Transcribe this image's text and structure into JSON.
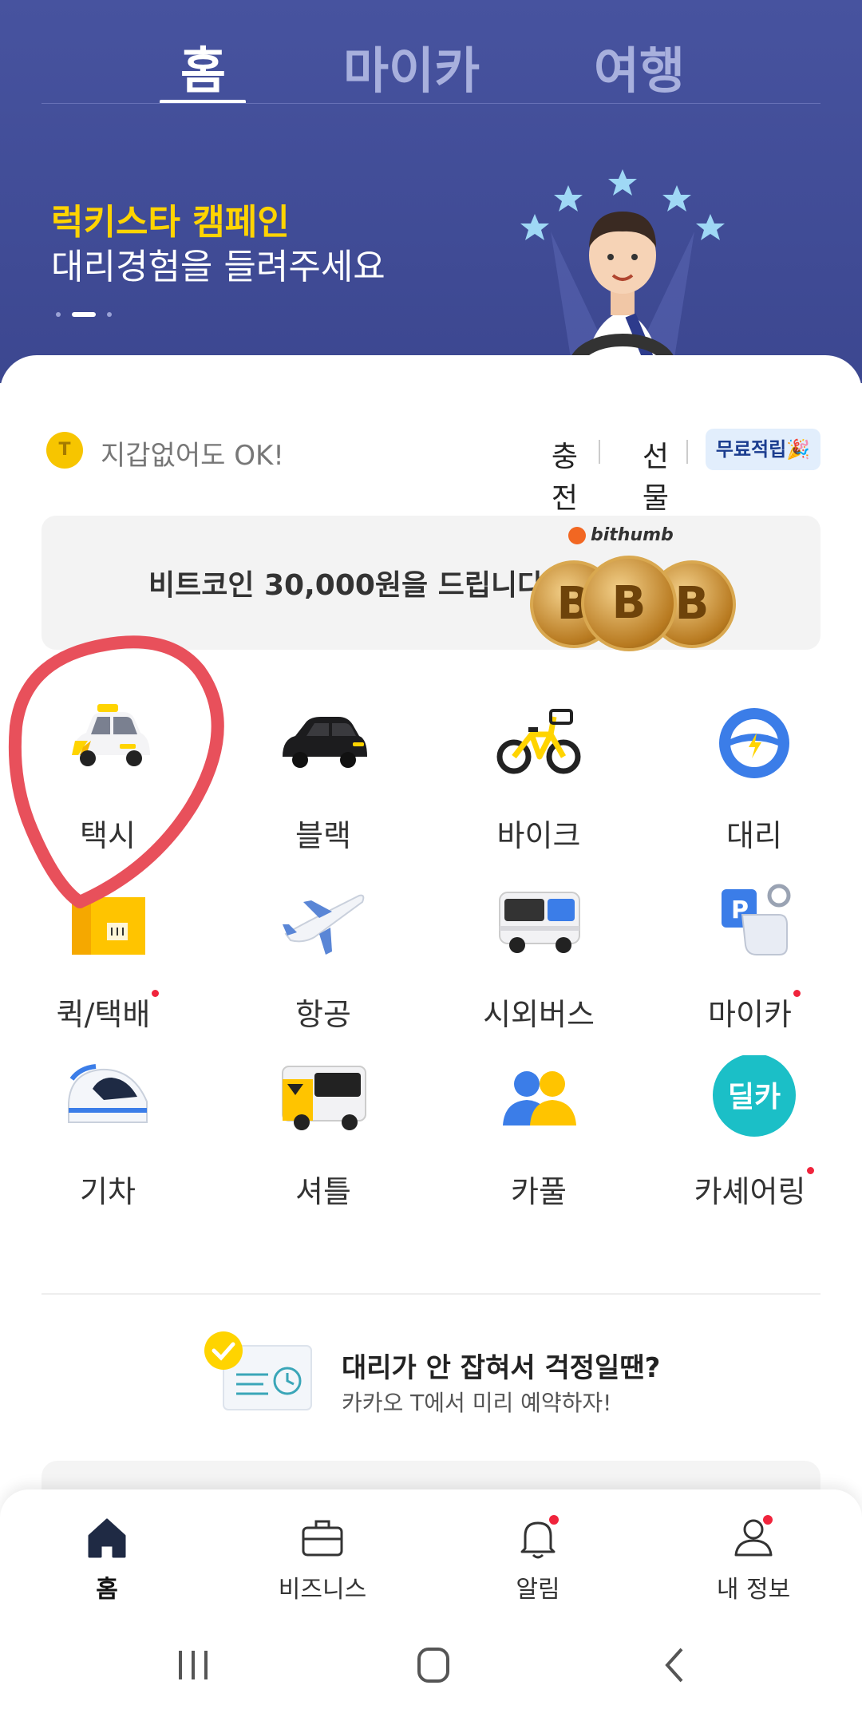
{
  "tabs": [
    {
      "label": "홈",
      "active": true
    },
    {
      "label": "마이카",
      "active": false
    },
    {
      "label": "여행",
      "active": false
    }
  ],
  "banner": {
    "title": "럭키스타 캠페인",
    "subtitle": "대리경험을 들려주세요",
    "page_count": 3,
    "active_page": 2
  },
  "wallet": {
    "coin_letter": "T",
    "text": "지갑없어도 OK!",
    "charge": "충전",
    "gift": "선물",
    "free_badge": "무료적립🎉"
  },
  "ad": {
    "text": "비트코인 30,000원을 드립니다",
    "brand": "bithumb",
    "coin_symbol": "B"
  },
  "services": [
    {
      "label": "택시",
      "icon": "taxi-icon",
      "badge": false
    },
    {
      "label": "블랙",
      "icon": "black-car-icon",
      "badge": false
    },
    {
      "label": "바이크",
      "icon": "bike-icon",
      "badge": false
    },
    {
      "label": "대리",
      "icon": "steering-wheel-icon",
      "badge": false
    },
    {
      "label": "퀵/택배",
      "icon": "package-icon",
      "badge": true
    },
    {
      "label": "항공",
      "icon": "airplane-icon",
      "badge": false
    },
    {
      "label": "시외버스",
      "icon": "bus-icon",
      "badge": false
    },
    {
      "label": "마이카",
      "icon": "parking-key-icon",
      "badge": true
    },
    {
      "label": "기차",
      "icon": "train-icon",
      "badge": false
    },
    {
      "label": "셔틀",
      "icon": "shuttle-icon",
      "badge": false
    },
    {
      "label": "카풀",
      "icon": "carpool-icon",
      "badge": false
    },
    {
      "label": "카셰어링",
      "icon": "carsharing-icon",
      "badge": true,
      "icon_text": "딜카"
    }
  ],
  "promo": {
    "title": "대리가 안 잡혀서 걱정일땐?",
    "subtitle": "카카오 T에서 미리 예약하자!"
  },
  "bottom_nav": [
    {
      "label": "홈",
      "icon": "home-icon",
      "active": true,
      "badge": false
    },
    {
      "label": "비즈니스",
      "icon": "briefcase-icon",
      "active": false,
      "badge": false
    },
    {
      "label": "알림",
      "icon": "bell-icon",
      "active": false,
      "badge": true
    },
    {
      "label": "내 정보",
      "icon": "profile-icon",
      "active": false,
      "badge": true
    }
  ],
  "colors": {
    "header_bg": "#47539f",
    "banner_title": "#ffd400",
    "badge_red": "#f0243c",
    "annotation_circle": "#e8505b"
  }
}
